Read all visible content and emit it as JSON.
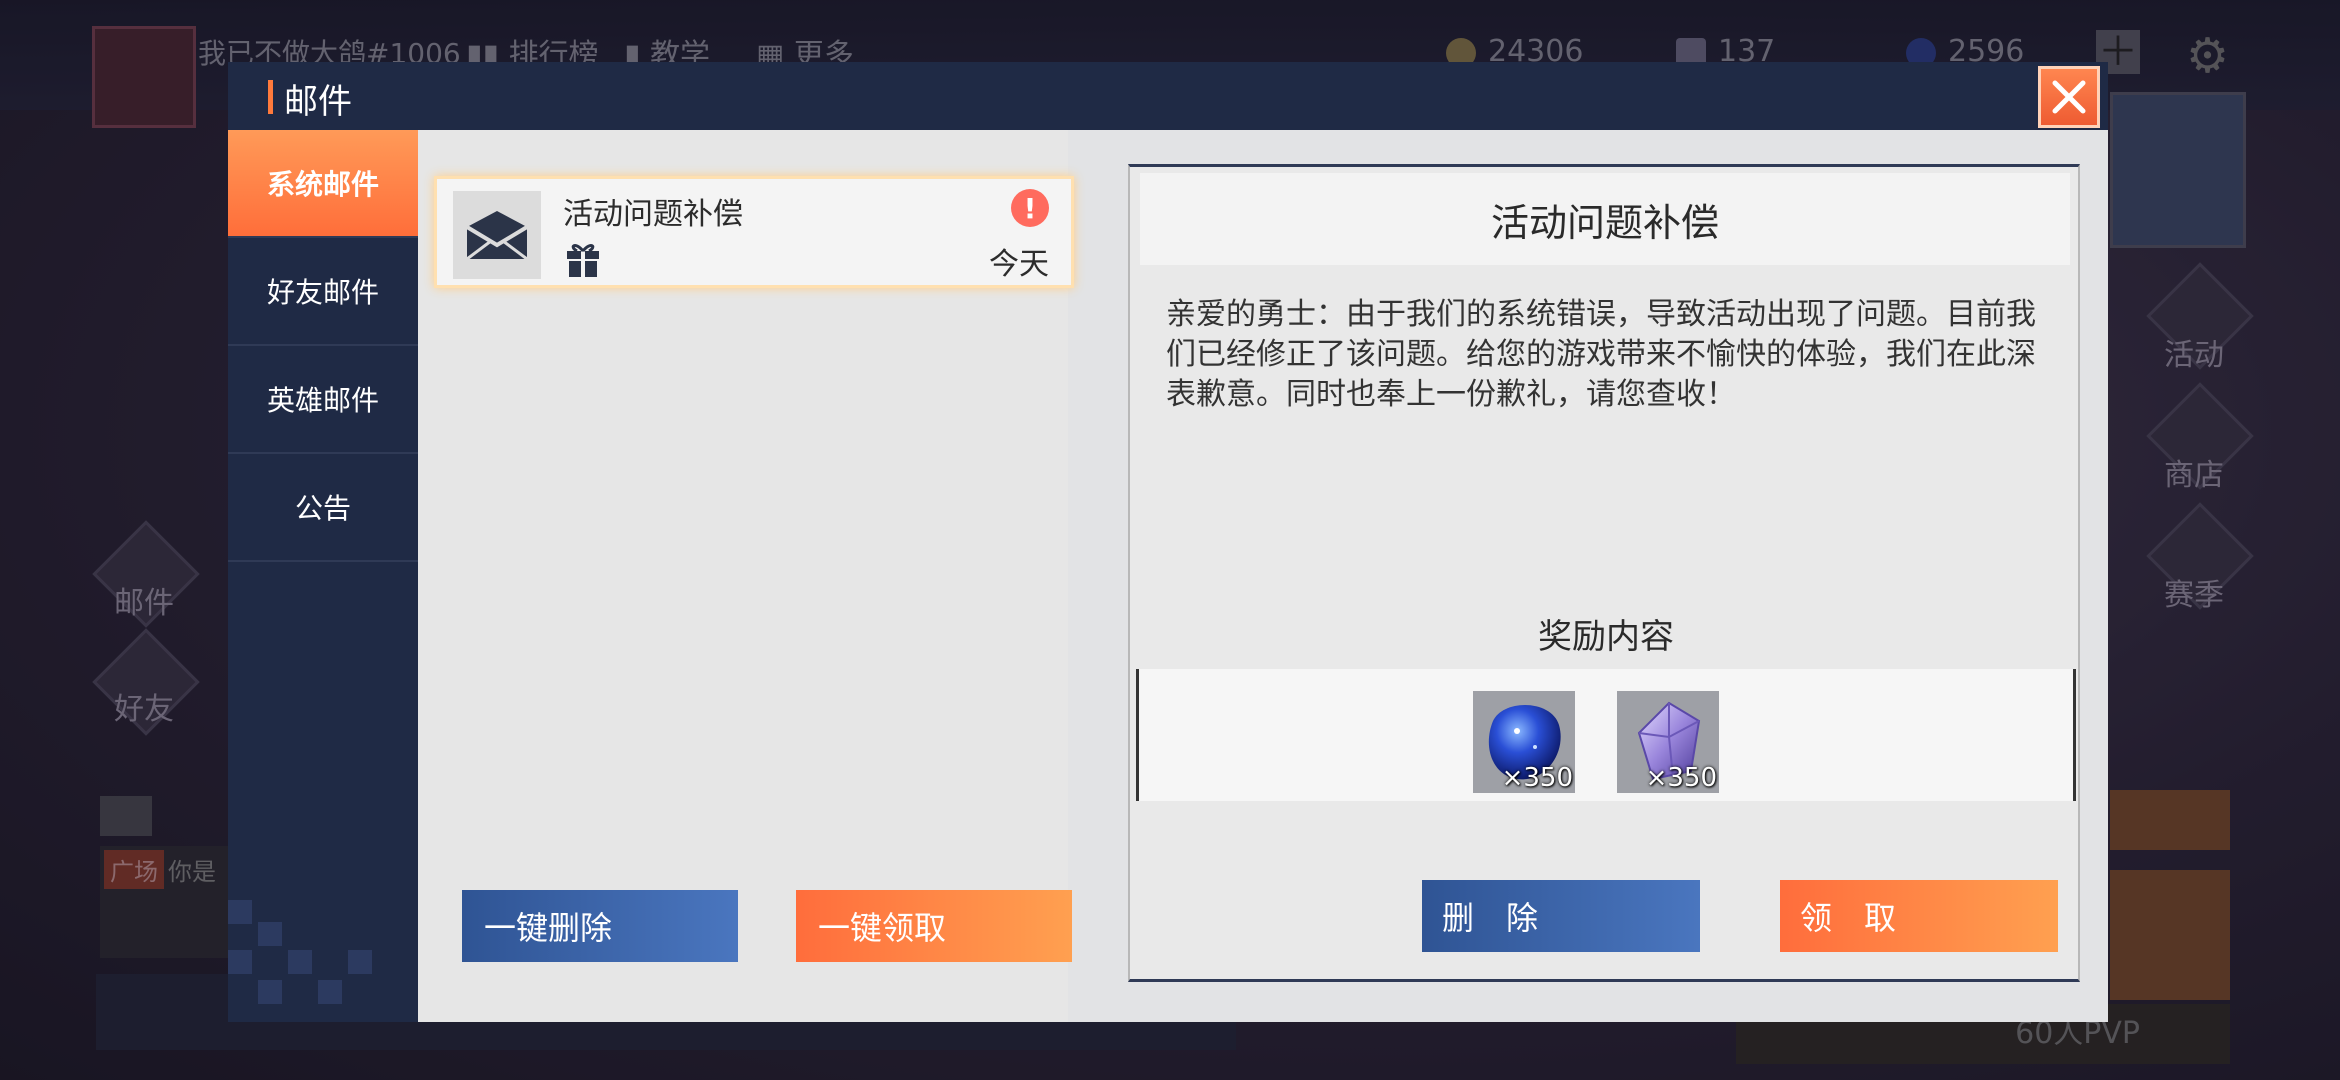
{
  "background": {
    "player_name": "我已不做大鸽#1006",
    "nav": [
      "排行榜",
      "教学",
      "更多"
    ],
    "currencies": [
      {
        "icon": "gold-coin-icon",
        "value": "24306"
      },
      {
        "icon": "crystal-icon",
        "value": "137"
      },
      {
        "icon": "blue-gem-icon",
        "value": "2596"
      }
    ],
    "right_menu": [
      "活动",
      "商店",
      "赛季"
    ],
    "left_menu": [
      "邮件",
      "好友"
    ],
    "chat": {
      "channel": "广场",
      "text": "你是"
    },
    "bottom_right": "60人PVP"
  },
  "dialog": {
    "title": "邮件",
    "tabs": [
      "系统邮件",
      "好友邮件",
      "英雄邮件",
      "公告"
    ],
    "active_tab": 0,
    "mail_list": [
      {
        "subject": "活动问题补偿",
        "date": "今天",
        "has_attachment": true,
        "unread": true
      }
    ],
    "list_buttons": {
      "delete_all": "一键删除",
      "claim_all": "一键领取"
    },
    "detail": {
      "title": "活动问题补偿",
      "body": "亲爱的勇士：由于我们的系统错误，导致活动出现了问题。目前我们已经修正了该问题。给您的游戏带来不愉快的体验，我们在此深表歉意。同时也奉上一份歉礼，请您查收！",
      "reward_title": "奖励内容",
      "rewards": [
        {
          "icon": "blue-gem-icon",
          "qty": "×350"
        },
        {
          "icon": "purple-crystal-icon",
          "qty": "×350"
        }
      ],
      "delete_label": "删　除",
      "claim_label": "领　取"
    }
  },
  "colors": {
    "accent_orange": "#ff7a3c",
    "panel_navy": "#1f2a45",
    "button_blue": "#3a63a8"
  }
}
